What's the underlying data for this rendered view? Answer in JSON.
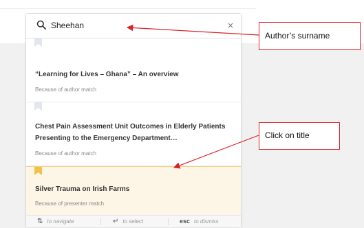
{
  "search": {
    "query": "Sheehan",
    "clear_glyph": "×"
  },
  "results": [
    {
      "title": "“Learning for Lives – Ghana” – An overview",
      "reason": "Because of author match",
      "selected": false
    },
    {
      "title": "Chest Pain Assessment Unit Outcomes in Elderly Patients Presenting to the Emergency Department…",
      "reason": "Because of author match",
      "selected": false
    },
    {
      "title": "Silver Trauma on Irish Farms",
      "reason": "Because of presenter match",
      "selected": true
    }
  ],
  "footer": {
    "navigate_key": "⇅",
    "navigate_label": "to navigate",
    "select_key": "↵",
    "select_label": "to select",
    "dismiss_key": "esc",
    "dismiss_label": "to dismiss"
  },
  "annotations": {
    "surname_label": "Author’s surname",
    "title_label": "Click on title"
  },
  "colors": {
    "annotation_red": "#d9232a",
    "selected_bg": "#fdf5e6",
    "bookmark_gray": "#e3e6ec",
    "bookmark_gold": "#f0c24a"
  },
  "icons": {
    "search": "search-icon",
    "clear": "close-icon",
    "bookmark": "bookmark-icon"
  }
}
